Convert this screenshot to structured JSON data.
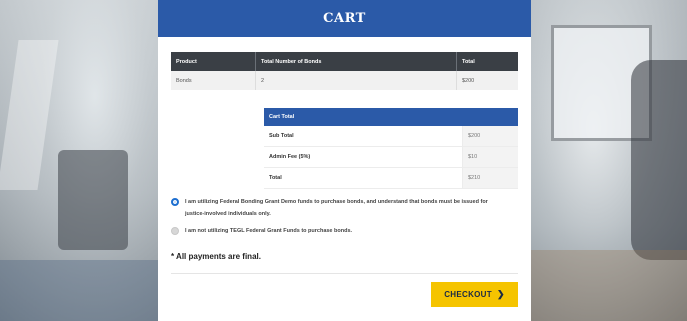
{
  "cart": {
    "title": "CART",
    "products_table": {
      "headers": [
        "Product",
        "Total Number of Bonds",
        "Total"
      ],
      "rows": [
        [
          "Bonds",
          "2",
          "$200"
        ]
      ]
    },
    "totals_table": {
      "header": "Cart Total",
      "rows": [
        {
          "label": "Sub Total",
          "value": "$200"
        },
        {
          "label": "Admin Fee (5%)",
          "value": "$10"
        },
        {
          "label": "Total",
          "value": "$210"
        }
      ]
    },
    "options": [
      {
        "text": "I am utilizing Federal Bonding Grant Demo funds to purchase bonds, and understand that bonds must be issued for justice-involved individuals only.",
        "selected": true
      },
      {
        "text": "I am not utilizing TEGL Federal Grant Funds to purchase bonds.",
        "selected": false
      }
    ],
    "final_note": "* All payments are final.",
    "checkout_label": "CHECKOUT",
    "checkout_icon": "chevron-right-icon"
  },
  "colors": {
    "header_blue": "#2b5aa8",
    "table_header_dark": "#3a3f45",
    "checkout_yellow": "#f5c400",
    "radio_selected": "#1e6fd0"
  }
}
